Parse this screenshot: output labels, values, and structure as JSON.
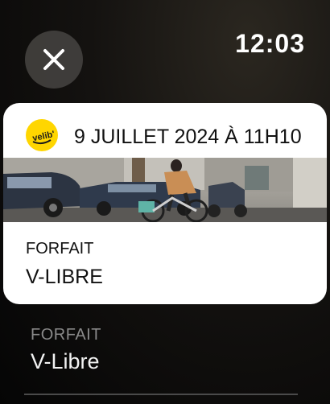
{
  "status_bar": {
    "time": "12:03"
  },
  "close_button": {
    "icon": "close-icon"
  },
  "pass_card": {
    "logo": {
      "icon": "velib-logo",
      "text": "velib'",
      "color": "#ffd600"
    },
    "date": "9 JUILLET 2024 À 11H10",
    "image": "cyclist-on-street-photo",
    "field_label": "FORFAIT",
    "field_value": "V-LIBRE"
  },
  "details": {
    "label": "FORFAIT",
    "value": "V-Libre"
  },
  "colors": {
    "card_background": "#ffffff",
    "logo_yellow": "#ffd600",
    "secondary_label": "#8a8a8a"
  }
}
